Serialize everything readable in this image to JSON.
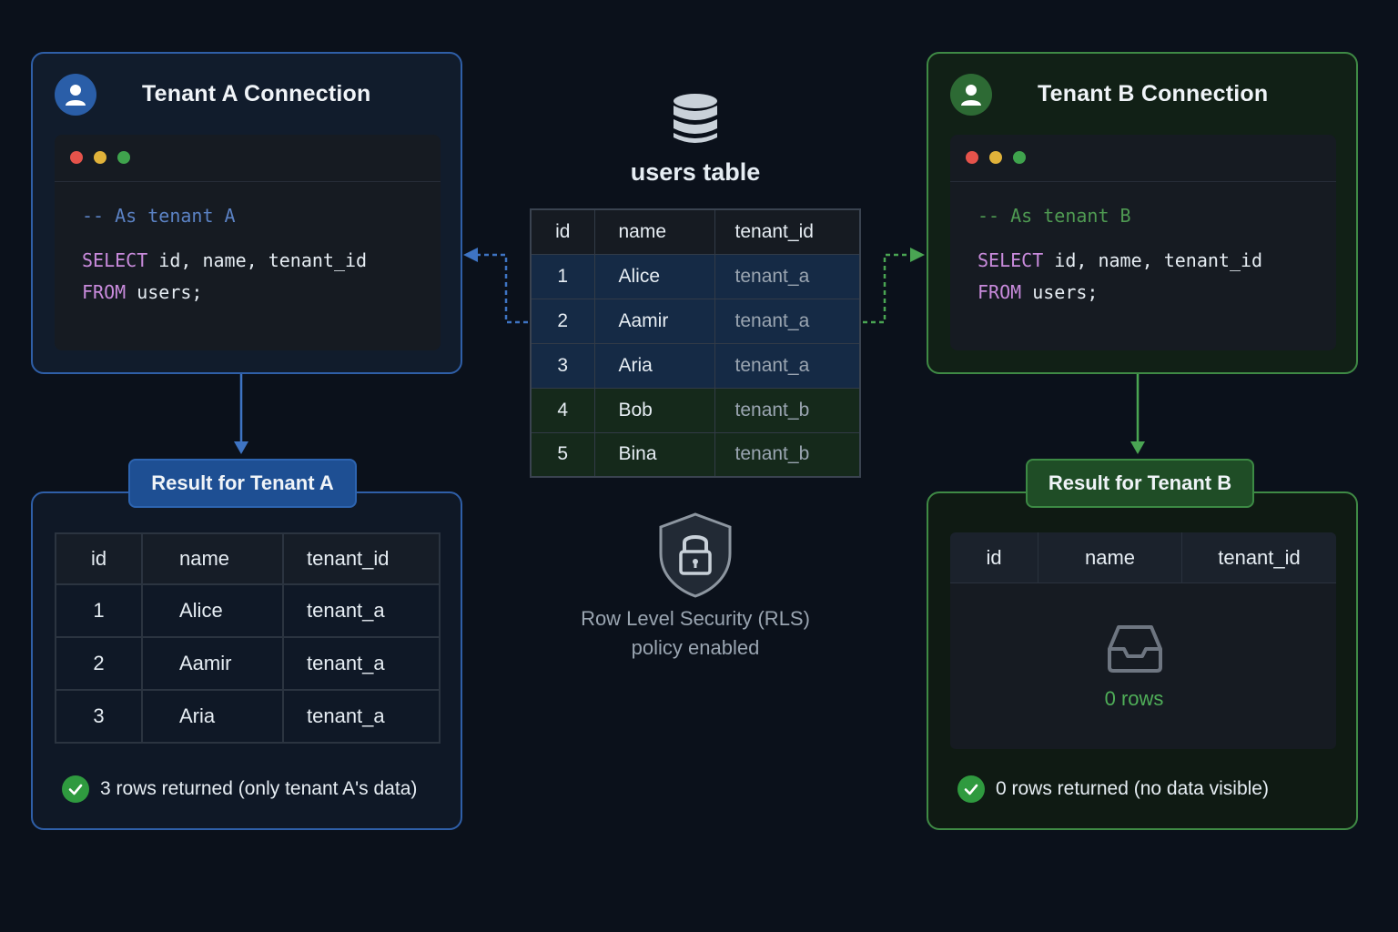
{
  "tenant_a": {
    "title": "Tenant A Connection",
    "comment": "-- As tenant A",
    "query_kw1": "SELECT",
    "query_cols": " id, name, tenant_id",
    "query_kw2": "FROM",
    "query_tbl": " users;",
    "result_tag": "Result for Tenant A",
    "columns": [
      "id",
      "name",
      "tenant_id"
    ],
    "rows": [
      [
        "1",
        "Alice",
        "tenant_a"
      ],
      [
        "2",
        "Aamir",
        "tenant_a"
      ],
      [
        "3",
        "Aria",
        "tenant_a"
      ]
    ],
    "status": "3 rows returned (only tenant A's data)",
    "accent": "#2f5fa8"
  },
  "tenant_b": {
    "title": "Tenant B Connection",
    "comment": "-- As tenant B",
    "query_kw1": "SELECT",
    "query_cols": " id, name, tenant_id",
    "query_kw2": "FROM",
    "query_tbl": " users;",
    "result_tag": "Result for Tenant B",
    "columns": [
      "id",
      "name",
      "tenant_id"
    ],
    "empty_label": "0 rows",
    "status": "0 rows returned (no data visible)",
    "accent": "#3f8a45"
  },
  "users_table": {
    "title": "users table",
    "columns": [
      "id",
      "name",
      "tenant_id"
    ],
    "rows": [
      {
        "id": "1",
        "name": "Alice",
        "tenant_id": "tenant_a"
      },
      {
        "id": "2",
        "name": "Aamir",
        "tenant_id": "tenant_a"
      },
      {
        "id": "3",
        "name": "Aria",
        "tenant_id": "tenant_a"
      },
      {
        "id": "4",
        "name": "Bob",
        "tenant_id": "tenant_b"
      },
      {
        "id": "5",
        "name": "Bina",
        "tenant_id": "tenant_b"
      }
    ]
  },
  "rls": {
    "line1": "Row Level Security (RLS)",
    "line2": "policy enabled"
  }
}
